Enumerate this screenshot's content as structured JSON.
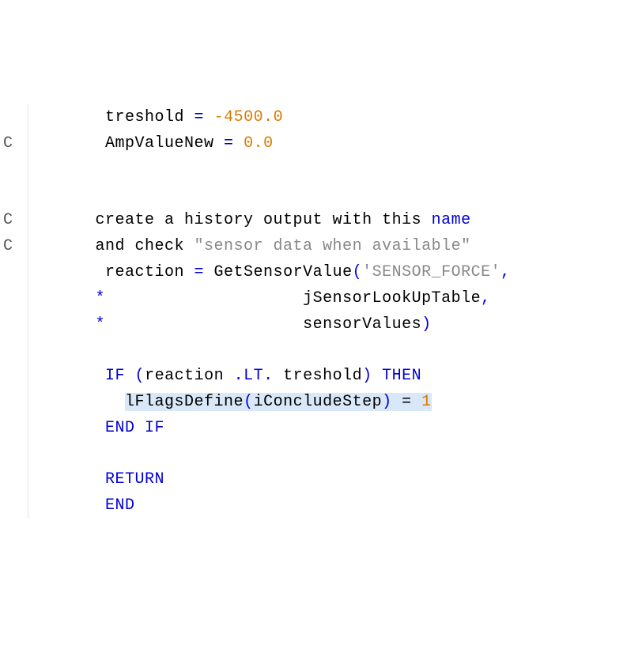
{
  "lines": [
    {
      "margin": "",
      "segments": [
        {
          "t": "      treshold ",
          "c": "var"
        },
        {
          "t": "=",
          "c": "op"
        },
        {
          "t": " ",
          "c": ""
        },
        {
          "t": "-4500.0",
          "c": "num"
        }
      ]
    },
    {
      "margin": "C",
      "segments": [
        {
          "t": "      AmpValueNew ",
          "c": "var"
        },
        {
          "t": "=",
          "c": "op"
        },
        {
          "t": " ",
          "c": ""
        },
        {
          "t": "0.0",
          "c": "num"
        }
      ]
    },
    {
      "margin": "",
      "segments": []
    },
    {
      "margin": "",
      "segments": []
    },
    {
      "margin": "C",
      "segments": [
        {
          "t": "     create a history output with this ",
          "c": "var"
        },
        {
          "t": "name",
          "c": "cmt-word-blue"
        }
      ]
    },
    {
      "margin": "C",
      "segments": [
        {
          "t": "     and check ",
          "c": "var"
        },
        {
          "t": "\"sensor data when available\"",
          "c": "str"
        }
      ]
    },
    {
      "margin": "",
      "segments": [
        {
          "t": "      reaction ",
          "c": "var"
        },
        {
          "t": "=",
          "c": "op"
        },
        {
          "t": " GetSensorValue",
          "c": "func"
        },
        {
          "t": "(",
          "c": "kw"
        },
        {
          "t": "'SENSOR_FORCE'",
          "c": "str"
        },
        {
          "t": ",",
          "c": "kw"
        }
      ]
    },
    {
      "margin": "",
      "segments": [
        {
          "t": "     ",
          "c": ""
        },
        {
          "t": "*",
          "c": "kw"
        },
        {
          "t": "                    jSensorLookUpTable",
          "c": "var"
        },
        {
          "t": ",",
          "c": "kw"
        }
      ]
    },
    {
      "margin": "",
      "segments": [
        {
          "t": "     ",
          "c": ""
        },
        {
          "t": "*",
          "c": "kw"
        },
        {
          "t": "                    sensorValues",
          "c": "var"
        },
        {
          "t": ")",
          "c": "kw"
        }
      ]
    },
    {
      "margin": "",
      "segments": []
    },
    {
      "margin": "",
      "segments": [
        {
          "t": "      ",
          "c": ""
        },
        {
          "t": "IF",
          "c": "kw"
        },
        {
          "t": " ",
          "c": ""
        },
        {
          "t": "(",
          "c": "kw"
        },
        {
          "t": "reaction ",
          "c": "var"
        },
        {
          "t": ".LT.",
          "c": "kw"
        },
        {
          "t": " treshold",
          "c": "var"
        },
        {
          "t": ")",
          "c": "kw"
        },
        {
          "t": " ",
          "c": ""
        },
        {
          "t": "THEN",
          "c": "kw"
        }
      ]
    },
    {
      "margin": "",
      "segments": [
        {
          "t": "        ",
          "c": ""
        },
        {
          "t": "lFlagsDefine",
          "c": "var",
          "hl": true
        },
        {
          "t": "(",
          "c": "kw",
          "hl": true
        },
        {
          "t": "iConcludeStep",
          "c": "var",
          "hl": true
        },
        {
          "t": ")",
          "c": "kw",
          "hl": true
        },
        {
          "t": " = ",
          "c": "var",
          "hl": true
        },
        {
          "t": "1",
          "c": "num",
          "hl": true
        }
      ]
    },
    {
      "margin": "",
      "segments": [
        {
          "t": "      ",
          "c": ""
        },
        {
          "t": "END IF",
          "c": "kw"
        }
      ]
    },
    {
      "margin": "",
      "segments": []
    },
    {
      "margin": "",
      "segments": [
        {
          "t": "      ",
          "c": ""
        },
        {
          "t": "RETURN",
          "c": "kw"
        }
      ]
    },
    {
      "margin": "",
      "segments": [
        {
          "t": "      ",
          "c": ""
        },
        {
          "t": "END",
          "c": "kw"
        }
      ]
    }
  ]
}
